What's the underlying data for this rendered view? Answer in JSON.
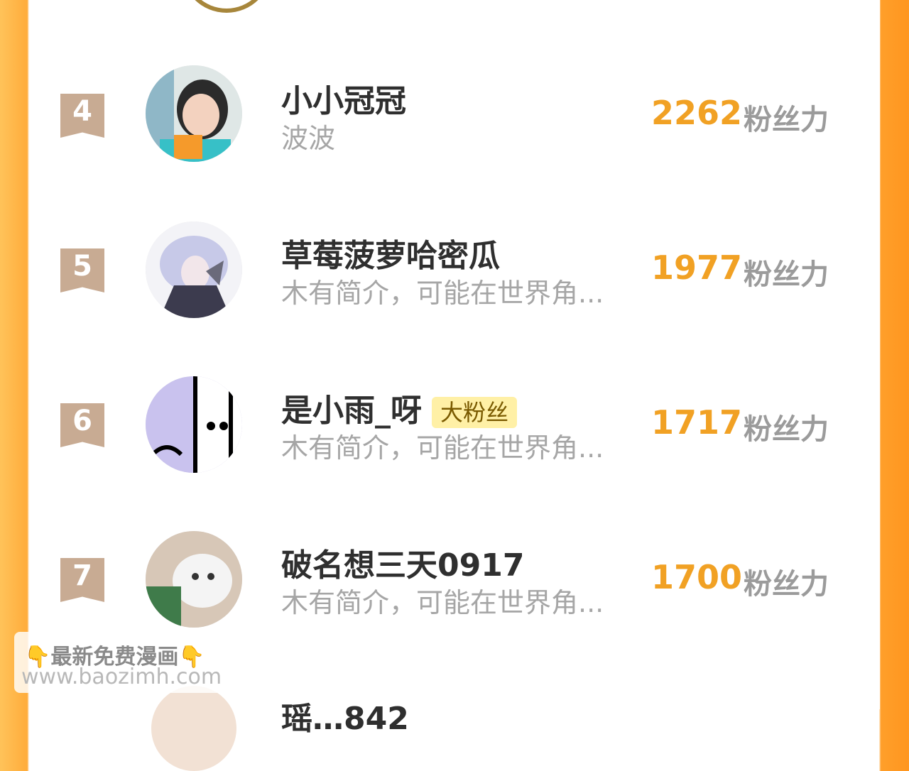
{
  "rows": [
    {
      "rank": "4",
      "name": "小小冠冠",
      "bio": "波波",
      "score": "2262",
      "unit": "粉丝力",
      "badge": ""
    },
    {
      "rank": "5",
      "name": "草莓菠萝哈密瓜",
      "bio": "木有简介，可能在世界角...",
      "score": "1977",
      "unit": "粉丝力",
      "badge": ""
    },
    {
      "rank": "6",
      "name": "是小雨_呀",
      "bio": "木有简介，可能在世界角...",
      "score": "1717",
      "unit": "粉丝力",
      "badge": "大粉丝"
    },
    {
      "rank": "7",
      "name": "破名想三天0917",
      "bio": "木有简介，可能在世界角...",
      "score": "1700",
      "unit": "粉丝力",
      "badge": ""
    }
  ],
  "next_row_partial_name": "瑶…842",
  "watermark": {
    "title": "👇最新免费漫画👇",
    "url": "www.baozimh.com"
  },
  "colors": {
    "accent": "#f1a124",
    "rank_bg": "#c8ab93",
    "badge_bg": "#fff0a6",
    "frame_orange": "#ffac3b"
  }
}
